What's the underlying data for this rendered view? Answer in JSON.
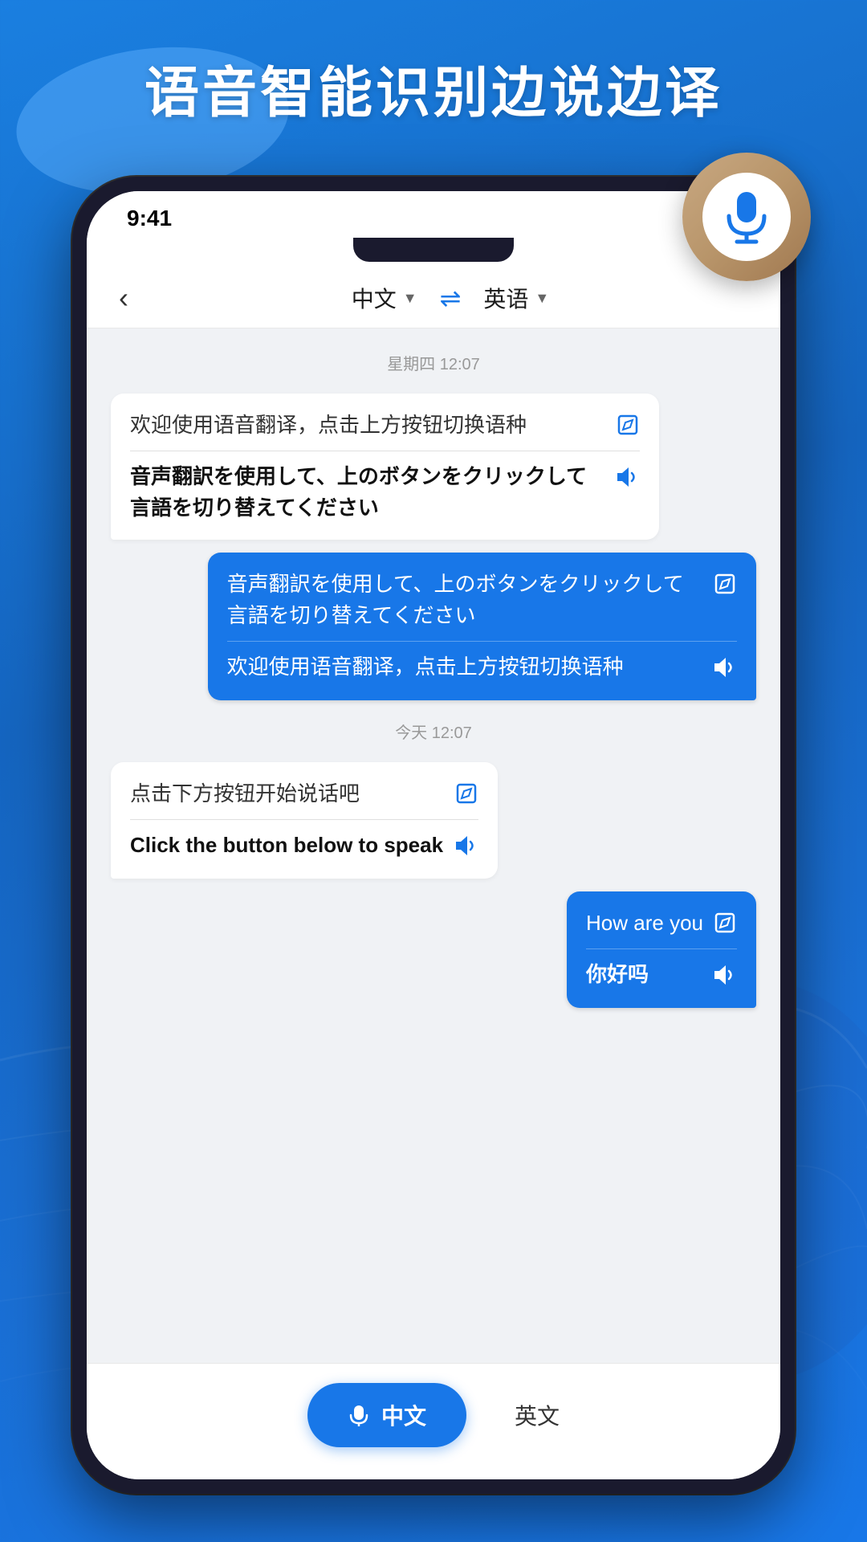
{
  "page": {
    "title": "语音智能识别边说边译",
    "background_color": "#1565c0"
  },
  "status_bar": {
    "time": "9:41"
  },
  "app_header": {
    "back_label": "‹",
    "lang_from": "中文",
    "lang_to": "英语",
    "swap_icon": "⇌"
  },
  "chat": {
    "timestamp1": "星期四 12:07",
    "timestamp2": "今天 12:07",
    "messages": [
      {
        "id": "msg1",
        "side": "left",
        "original": "欢迎使用语音翻译，点击上方按钮切换语种",
        "translated": "音声翻訳を使用して、上のボタンをクリックして言語を切り替えてください",
        "translated_bold": true
      },
      {
        "id": "msg2",
        "side": "right",
        "original": "音声翻訳を使用して、上のボタンをクリックして言語を切り替えてください",
        "translated": "欢迎使用语音翻译，点击上方按钮切换语种"
      },
      {
        "id": "msg3",
        "side": "left",
        "original": "点击下方按钮开始说话吧",
        "translated": "Click the button below to speak",
        "translated_bold": true
      },
      {
        "id": "msg4",
        "side": "right",
        "original": "How are you",
        "translated": "你好吗"
      }
    ]
  },
  "bottom_bar": {
    "mic_label": "中文",
    "lang_option": "英文"
  }
}
